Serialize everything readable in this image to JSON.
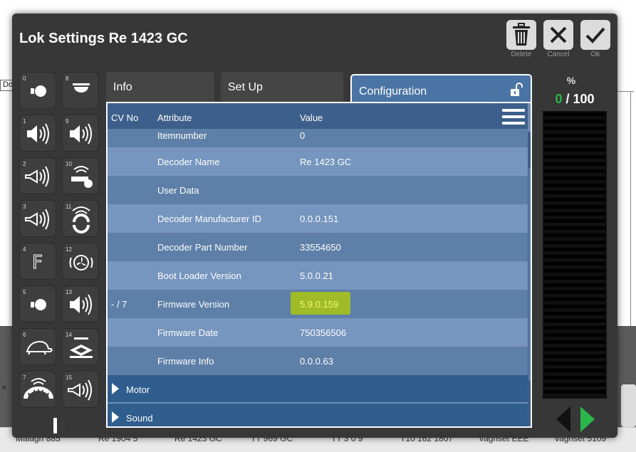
{
  "background": {
    "box_label": "Do",
    "close_x": "✕",
    "tabs": [
      "Malagh 885",
      "Re 1904 5",
      "Re 1423 GC",
      "TT 969 GC",
      "TT 3 0 9",
      "T10 162 1807",
      "Vagnset EEE",
      "Vagnset 5109"
    ]
  },
  "dialog": {
    "title": "Lok Settings Re 1423 GC",
    "buttons": {
      "delete": {
        "label": "Delete",
        "icon": "trash-icon"
      },
      "cancel": {
        "label": "Cancel",
        "icon": "close-icon"
      },
      "ok": {
        "label": "Ok",
        "icon": "check-icon"
      }
    }
  },
  "functions": [
    {
      "num": "0",
      "icon": "headlight-icon"
    },
    {
      "num": "8",
      "icon": "ceiling-light-icon"
    },
    {
      "num": "1",
      "icon": "speaker-icon"
    },
    {
      "num": "9",
      "icon": "speaker-icon"
    },
    {
      "num": "2",
      "icon": "horn-icon"
    },
    {
      "num": "10",
      "icon": "whistle-icon"
    },
    {
      "num": "3",
      "icon": "horn-icon"
    },
    {
      "num": "11",
      "icon": "coupler-sound-icon"
    },
    {
      "num": "4",
      "icon": "f-letter-icon",
      "text": "F"
    },
    {
      "num": "12",
      "icon": "fan-icon"
    },
    {
      "num": "5",
      "icon": "headlight-icon"
    },
    {
      "num": "13",
      "icon": "speaker-icon"
    },
    {
      "num": "6",
      "icon": "turtle-icon"
    },
    {
      "num": "14",
      "icon": "pantograph-icon"
    },
    {
      "num": "7",
      "icon": "wheel-sound-icon"
    },
    {
      "num": "15",
      "icon": "horn-icon"
    }
  ],
  "tabs": {
    "info": "Info",
    "setup": "Set Up",
    "configuration": "Configuration"
  },
  "table": {
    "headers": {
      "cv": "CV No",
      "attribute": "Attribute",
      "value": "Value"
    },
    "rows": [
      {
        "cv": "",
        "attribute": "Itemnumber",
        "value": "0"
      },
      {
        "cv": "",
        "attribute": "Decoder Name",
        "value": "Re 1423 GC"
      },
      {
        "cv": "",
        "attribute": "User Data",
        "value": ""
      },
      {
        "cv": "",
        "attribute": "Decoder Manufacturer ID",
        "value": "0.0.0.151"
      },
      {
        "cv": "",
        "attribute": "Decoder Part Number",
        "value": "33554650"
      },
      {
        "cv": "",
        "attribute": "Boot Loader Version",
        "value": "5.0.0.21"
      },
      {
        "cv": "- / 7",
        "attribute": "Firmware Version",
        "value": "5.9.0.159",
        "highlight": true
      },
      {
        "cv": "",
        "attribute": "Firmware Date",
        "value": "750356506"
      },
      {
        "cv": "",
        "attribute": "Firmware Info",
        "value": "0.0.0.63"
      }
    ],
    "sections": [
      "Motor",
      "Sound"
    ]
  },
  "speed": {
    "label": "%",
    "current": "0",
    "separator": " / ",
    "max": "100",
    "fraction": 0,
    "colors": {
      "current": "#2bb64b",
      "active_arrow": "#2bb64b"
    }
  }
}
